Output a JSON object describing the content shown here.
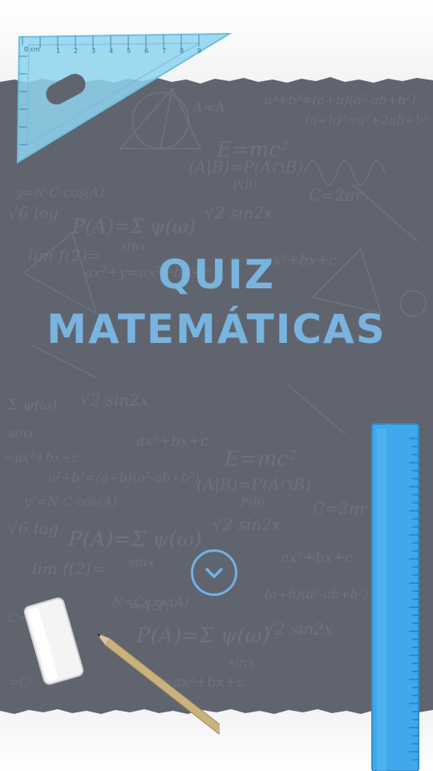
{
  "header": {
    "title_line1": "QUIZ",
    "title_line2": "MATEMÁTICAS"
  },
  "actions": {
    "scroll_down_icon": "chevron-down-icon"
  },
  "decorations": {
    "icons": [
      "set-square-icon",
      "ruler-icon",
      "eraser-icon",
      "pencil-icon"
    ]
  },
  "colors": {
    "chalkboard": "#606570",
    "title": "#79b4df",
    "accent": "#6fb2e6",
    "ruler": "#3fa8ec",
    "set_square": "#8fd3ee"
  }
}
